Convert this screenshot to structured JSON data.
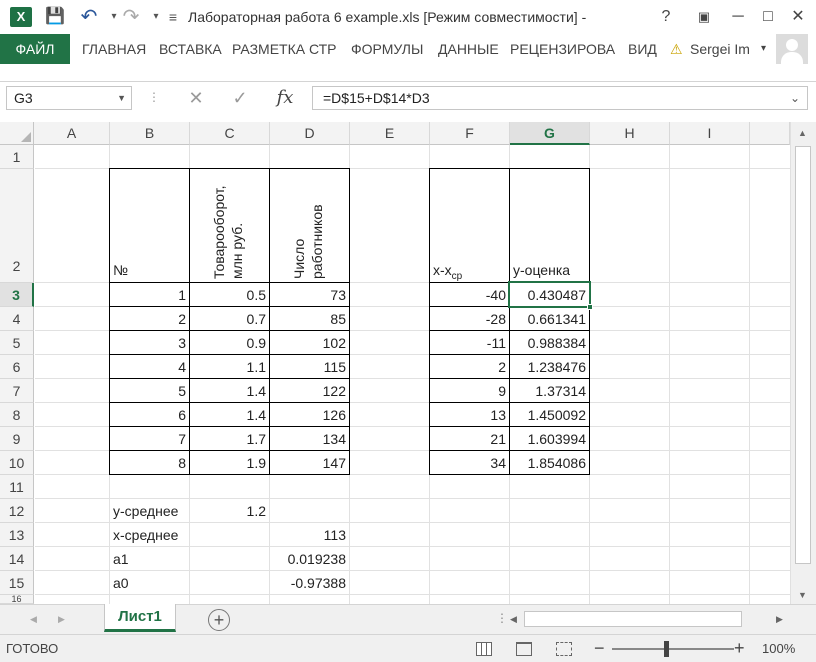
{
  "app": {
    "logo": "X",
    "title": "Лабораторная работа 6 example.xls  [Режим совместимости]  -",
    "help": "?",
    "minimize": "─",
    "maximize": "□",
    "close": "✕"
  },
  "quick_access": {
    "save": "💾",
    "undo": "↶",
    "redo": "↷"
  },
  "ribbon": {
    "file": "ФАЙЛ",
    "tabs": [
      "ГЛАВНАЯ",
      "ВСТАВКА",
      "РАЗМЕТКА СТР",
      "ФОРМУЛЫ",
      "ДАННЫЕ",
      "РЕЦЕНЗИРОВА",
      "ВИД"
    ],
    "user": "Sergei Im",
    "warning": "⚠"
  },
  "formula_bar": {
    "name_box": "G3",
    "cancel": "✕",
    "enter": "✓",
    "fx": "fx",
    "formula": "=D$15+D$14*D3"
  },
  "columns": [
    "A",
    "B",
    "C",
    "D",
    "E",
    "F",
    "G",
    "H",
    "I"
  ],
  "rows": [
    "1",
    "2",
    "3",
    "4",
    "5",
    "6",
    "7",
    "8",
    "9",
    "10",
    "11",
    "12",
    "13",
    "14",
    "15",
    "16"
  ],
  "table1": {
    "header_no": "№",
    "header_c": "Товарооборот, млн руб.",
    "header_d": "Число работников",
    "no": [
      "1",
      "2",
      "3",
      "4",
      "5",
      "6",
      "7",
      "8"
    ],
    "c": [
      "0.5",
      "0.7",
      "0.9",
      "1.1",
      "1.4",
      "1.4",
      "1.7",
      "1.9"
    ],
    "d": [
      "73",
      "85",
      "102",
      "115",
      "122",
      "126",
      "134",
      "147"
    ]
  },
  "table2": {
    "header_f": "x-x",
    "header_f_sub": "ср",
    "header_g": "y-оценка",
    "f": [
      "-40",
      "-28",
      "-11",
      "2",
      "9",
      "13",
      "21",
      "34"
    ],
    "g": [
      "0.430487",
      "0.661341",
      "0.988384",
      "1.238476",
      "1.37314",
      "1.450092",
      "1.603994",
      "1.854086"
    ]
  },
  "summary": {
    "b12": "y-среднее",
    "c12": "1.2",
    "b13": "x-среднее",
    "d13": "113",
    "b14": "a1",
    "d14": "0.019238",
    "b15": "a0",
    "d15": "-0.97388"
  },
  "sheet": {
    "tab": "Лист1",
    "add": "+"
  },
  "status": {
    "ready": "ГОТОВО",
    "zoom": "100%",
    "minus": "−",
    "plus": "+"
  }
}
